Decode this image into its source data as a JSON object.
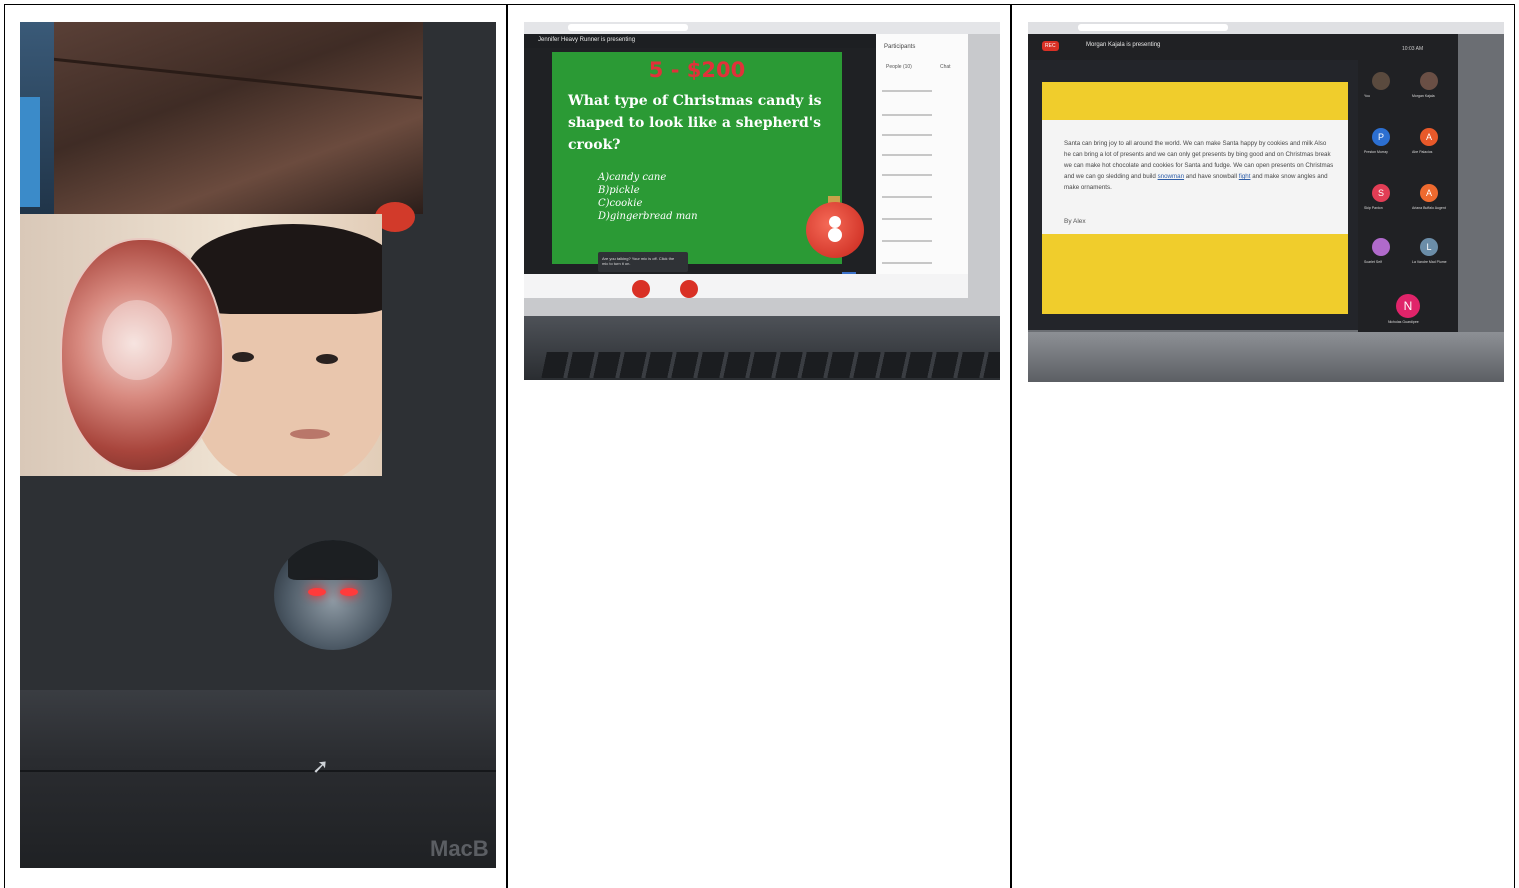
{
  "photo1": {
    "laptop_brand": "MacB"
  },
  "photo2": {
    "presenter_banner": "Jennifer Heavy Runner is presenting",
    "panel_title": "Participants",
    "panel_tabs": [
      "People (10)",
      "Chat"
    ],
    "slide": {
      "title": "5 - $200",
      "question": "What type of Christmas candy is shaped to look like a shepherd's crook?",
      "options": [
        "A)candy cane",
        "B)pickle",
        "C)cookie",
        "D)gingerbread man"
      ]
    },
    "toast": "Are you talking? Your mic is off. Click the mic to turn it on."
  },
  "photo3": {
    "rec_label": "REC",
    "presenter_banner": "Morgan Kajala is presenting",
    "clock": "10:03 AM",
    "paragraph_parts": [
      "Santa can bring joy to all around the world. We can make Santa happy by cookies and milk Also he can bring a lot of presents and we can only get presents by bing good and on  Christmas break we can make hot chocolate and cookies for Santa and fudge. We can open presents on Christmas and we can go sledding and build ",
      "snowman",
      " and have snowball ",
      "fight",
      " and make snow angles and make ornaments."
    ],
    "byline": "By Alex",
    "participants": [
      {
        "initial": "",
        "name": "You",
        "color": "#5a4a3e"
      },
      {
        "initial": "",
        "name": "Morgan Kajala",
        "color": "#6a4f45"
      },
      {
        "initial": "P",
        "name": "Preston Murray",
        "color": "#2c6fd1"
      },
      {
        "initial": "A",
        "name": "Abe Palacios",
        "color": "#e8592a"
      },
      {
        "initial": "S",
        "name": "Skip Paxton",
        "color": "#e23d55"
      },
      {
        "initial": "A",
        "name": "Ariana Buffalo Augent",
        "color": "#ee6a2f"
      },
      {
        "initial": "",
        "name": "Scarlet Self",
        "color": "#b06acb"
      },
      {
        "initial": "L",
        "name": "La Vandre Mad Plume",
        "color": "#6b8da8"
      },
      {
        "initial": "N",
        "name": "Nicholas Guardipee",
        "color": "#e0246a"
      }
    ]
  },
  "colors": {
    "slide_green": "#2b9a35",
    "slide_title_red": "#e0323a",
    "slide_yellow": "#f0cd2c",
    "meet_dark": "#202124"
  }
}
